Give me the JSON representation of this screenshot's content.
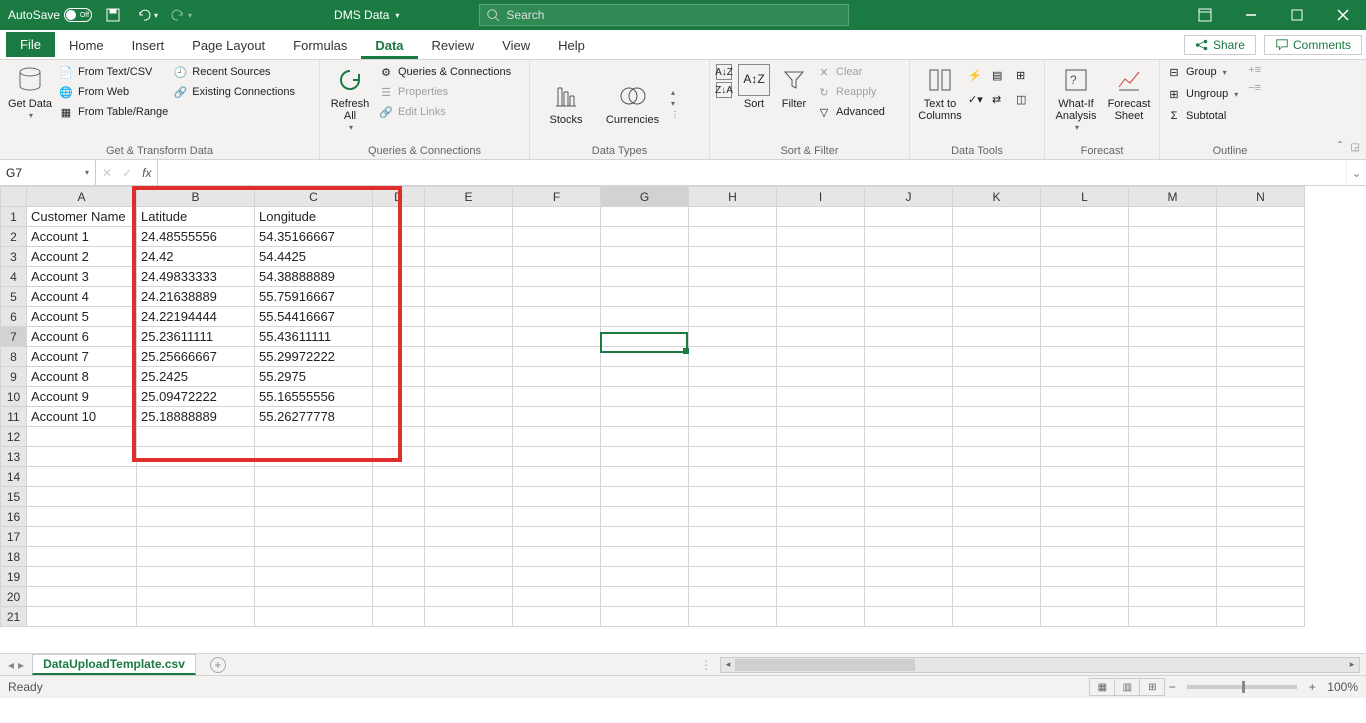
{
  "titlebar": {
    "autosave_label": "AutoSave",
    "autosave_state": "Off",
    "doc_name": "DMS Data",
    "search_placeholder": "Search"
  },
  "tabs": [
    "File",
    "Home",
    "Insert",
    "Page Layout",
    "Formulas",
    "Data",
    "Review",
    "View",
    "Help"
  ],
  "active_tab": "Data",
  "share_label": "Share",
  "comments_label": "Comments",
  "ribbon": {
    "get_data": {
      "big": "Get Data",
      "items": [
        "From Text/CSV",
        "From Web",
        "From Table/Range",
        "Recent Sources",
        "Existing Connections"
      ],
      "group": "Get & Transform Data"
    },
    "refresh": {
      "big": "Refresh All",
      "items": [
        "Queries & Connections",
        "Properties",
        "Edit Links"
      ],
      "group": "Queries & Connections"
    },
    "dtypes": {
      "items": [
        "Stocks",
        "Currencies"
      ],
      "group": "Data Types"
    },
    "sort": {
      "big": "Sort",
      "filter": "Filter",
      "items": [
        "Clear",
        "Reapply",
        "Advanced"
      ],
      "group": "Sort & Filter"
    },
    "tools": {
      "big": "Text to Columns",
      "group": "Data Tools"
    },
    "forecast": {
      "items": [
        "What-If Analysis",
        "Forecast Sheet"
      ],
      "group": "Forecast"
    },
    "outline": {
      "items": [
        "Group",
        "Ungroup",
        "Subtotal"
      ],
      "group": "Outline"
    }
  },
  "namebox": "G7",
  "formula": "",
  "columns": [
    "A",
    "B",
    "C",
    "D",
    "E",
    "F",
    "G",
    "H",
    "I",
    "J",
    "K",
    "L",
    "M",
    "N"
  ],
  "row_count": 21,
  "selected_cell": {
    "col": "G",
    "row": 7
  },
  "headers": {
    "A": "Customer Name",
    "B": "Latitude",
    "C": "Longitude"
  },
  "data_rows": [
    {
      "A": "Account 1",
      "B": "24.48555556",
      "C": "54.35166667"
    },
    {
      "A": "Account 2",
      "B": "24.42",
      "C": "54.4425"
    },
    {
      "A": "Account 3",
      "B": "24.49833333",
      "C": "54.38888889"
    },
    {
      "A": "Account 4",
      "B": "24.21638889",
      "C": "55.75916667"
    },
    {
      "A": "Account 5",
      "B": "24.22194444",
      "C": "55.54416667"
    },
    {
      "A": "Account 6",
      "B": "25.23611111",
      "C": "55.43611111"
    },
    {
      "A": "Account 7",
      "B": "25.25666667",
      "C": "55.29972222"
    },
    {
      "A": "Account 8",
      "B": "25.2425",
      "C": "55.2975"
    },
    {
      "A": "Account 9",
      "B": "25.09472222",
      "C": "55.16555556"
    },
    {
      "A": "Account 10",
      "B": "25.18888889",
      "C": "55.26277778"
    }
  ],
  "sheet_tab": "DataUploadTemplate.csv",
  "status": "Ready",
  "zoom": "100%"
}
